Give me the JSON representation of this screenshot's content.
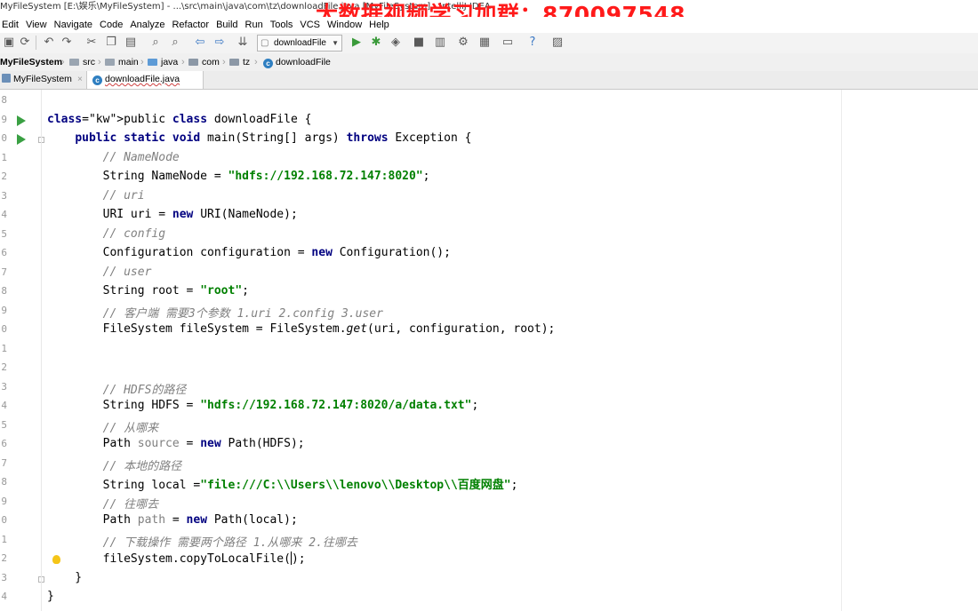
{
  "window": {
    "title": "MyFileSystem [E:\\娱乐\\MyFileSystem] - ...\\src\\main\\java\\com\\tz\\downloadFile.java [MyFileSystem] - IntelliJ IDEA",
    "watermark": "大数据视频学习加群：870097548"
  },
  "menu": [
    "Edit",
    "View",
    "Navigate",
    "Code",
    "Analyze",
    "Refactor",
    "Build",
    "Run",
    "Tools",
    "VCS",
    "Window",
    "Help"
  ],
  "toolbar": {
    "run_config": "downloadFile",
    "icons": [
      "save-icon",
      "sync-icon",
      "undo-icon",
      "redo-icon",
      "cut-icon",
      "copy-icon",
      "paste-icon",
      "find-icon",
      "replace-icon",
      "back-icon",
      "forward-icon",
      "build-icon",
      "run-icon",
      "debug-icon",
      "coverage-icon",
      "stop-icon",
      "project-structure-icon",
      "sdk-icon",
      "settings-icon",
      "help-icon",
      "terminal-icon"
    ]
  },
  "breadcrumb": [
    "MyFileSystem",
    "src",
    "main",
    "java",
    "com",
    "tz",
    "downloadFile"
  ],
  "tabs": [
    {
      "label": "MyFileSystem",
      "active": false
    },
    {
      "label": "downloadFile.java",
      "active": true
    }
  ],
  "editor": {
    "line_numbers": [
      "8",
      "9",
      "0",
      "1",
      "2",
      "3",
      "4",
      "5",
      "6",
      "7",
      "8",
      "9",
      "0",
      "1",
      "2",
      "3",
      "4",
      "5",
      "6",
      "7",
      "8",
      "9",
      "0",
      "1",
      "2",
      "3",
      "4"
    ],
    "lines": [
      {
        "t": ""
      },
      {
        "t": "public class downloadFile {",
        "k": [
          "public",
          "class"
        ]
      },
      {
        "t": "    public static void main(String[] args) throws Exception {",
        "k": [
          "public",
          "static",
          "void",
          "throws"
        ]
      },
      {
        "t": "        // NameNode",
        "c": true
      },
      {
        "t": "        String NameNode = \"hdfs://192.168.72.147:8020\";"
      },
      {
        "t": "        // uri",
        "c": true
      },
      {
        "t": "        URI uri = new URI(NameNode);",
        "k": [
          "new"
        ]
      },
      {
        "t": "        // config",
        "c": true
      },
      {
        "t": "        Configuration configuration = new Configuration();",
        "k": [
          "new"
        ]
      },
      {
        "t": "        // user",
        "c": true
      },
      {
        "t": "        String root = \"root\";"
      },
      {
        "t": "        // 客户端 需要3个参数 1.uri 2.config 3.user",
        "c": true
      },
      {
        "t": "        FileSystem fileSystem = FileSystem.get(uri, configuration, root);",
        "i": "get"
      },
      {
        "t": ""
      },
      {
        "t": ""
      },
      {
        "t": "        // HDFS的路径",
        "c": true
      },
      {
        "t": "        String HDFS = \"hdfs://192.168.72.147:8020/a/data.txt\";"
      },
      {
        "t": "        // 从哪来",
        "c": true
      },
      {
        "t": "        Path source = new Path(HDFS);",
        "k": [
          "new"
        ],
        "u": "source"
      },
      {
        "t": "        // 本地的路径",
        "c": true
      },
      {
        "t": "        String local =\"file:///C:\\\\Users\\\\lenovo\\\\Desktop\\\\百度网盘\";"
      },
      {
        "t": "        // 往哪去",
        "c": true
      },
      {
        "t": "        Path path = new Path(local);",
        "k": [
          "new"
        ],
        "u": "path"
      },
      {
        "t": "        // 下载操作 需要两个路径 1.从哪来 2.往哪去",
        "c": true
      },
      {
        "t": "        fileSystem.copyToLocalFile();",
        "caret": 28
      },
      {
        "t": "    }"
      },
      {
        "t": "}"
      }
    ]
  }
}
